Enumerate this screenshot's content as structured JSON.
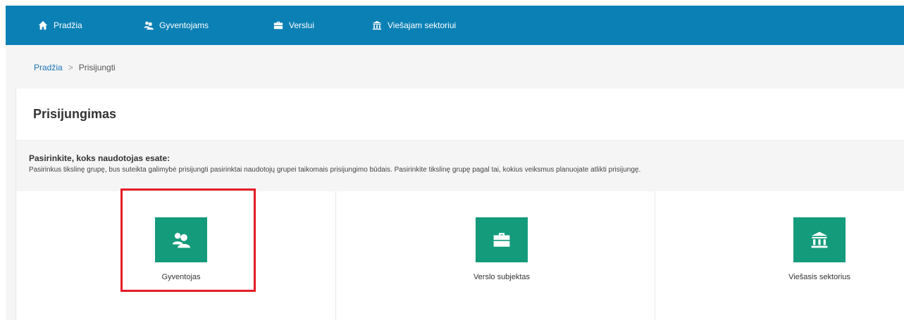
{
  "nav": {
    "items": [
      {
        "label": "Pradžia",
        "icon": "home-icon"
      },
      {
        "label": "Gyventojams",
        "icon": "users-icon"
      },
      {
        "label": "Verslui",
        "icon": "briefcase-icon"
      },
      {
        "label": "Viešajam sektoriui",
        "icon": "institution-icon"
      }
    ],
    "background": "#0b80b5"
  },
  "breadcrumb": {
    "home": "Pradžia",
    "separator": ">",
    "current": "Prisijungti"
  },
  "page": {
    "title": "Prisijungimas",
    "intro_heading": "Pasirinkite, koks naudotojas esate:",
    "intro_text": "Pasirinkus tikslinę grupę, bus suteikta galimybė prisijungti pasirinktai naudotojų grupei taikomais prisijungimo būdais. Pasirinkite tikslinę grupę pagal tai, kokius veiksmus planuojate atlikti prisijungę."
  },
  "options": [
    {
      "label": "Gyventojas",
      "icon": "users-icon",
      "highlighted": true
    },
    {
      "label": "Verslo subjektas",
      "icon": "briefcase-icon",
      "highlighted": false
    },
    {
      "label": "Viešasis sektorius",
      "icon": "institution-icon",
      "highlighted": false
    }
  ],
  "colors": {
    "accent_green": "#149b7b",
    "highlight_red": "#e31e24",
    "link_blue": "#1a73b5"
  }
}
